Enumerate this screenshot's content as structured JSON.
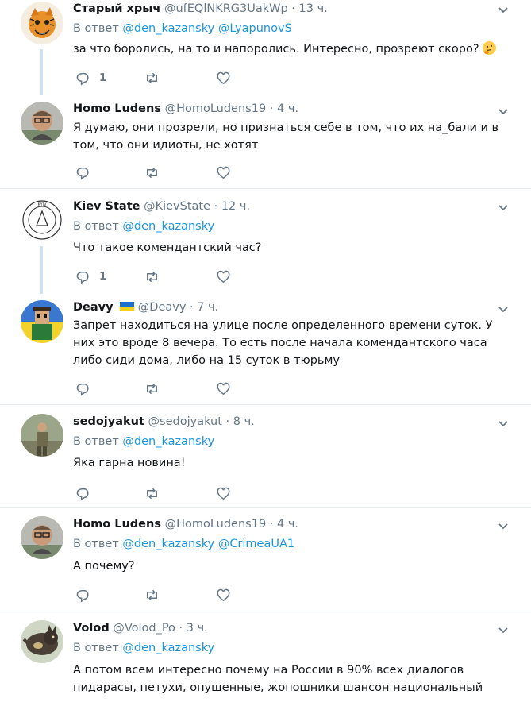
{
  "reply_prefix": "В ответ",
  "tweets": [
    {
      "name": "Старый хрыч",
      "handle": "@ufEQlNKRG3UakWp",
      "time": "13 ч.",
      "mentions": [
        "@den_kazansky",
        "@LyapunovS"
      ],
      "text": "за что боролись, на то и напоролись. Интересно, прозреют скоро?",
      "emoji": "thinking-face",
      "reply_count": "1"
    },
    {
      "name": "Homo Ludens",
      "handle": "@HomoLudens19",
      "time": "4 ч.",
      "mentions": [],
      "text": "Я думаю, они прозрели, но признаться себе в том, что их на_бали и в том, что они идиоты, не хотят",
      "reply_count": ""
    },
    {
      "name": "Kiev State",
      "handle": "@KievState",
      "time": "12 ч.",
      "mentions": [
        "@den_kazansky"
      ],
      "text": "Что такое комендантский час?",
      "reply_count": "1"
    },
    {
      "name": "Deavy",
      "handle": "@Deavy",
      "time": "7 ч.",
      "mentions": [],
      "text": "Запрет находиться на улице после определенного времени суток. У них это вроде 8 вечера. То есть после начала комендантского часа либо сиди дома, либо на 15 суток в тюрьму",
      "reply_count": ""
    },
    {
      "name": "sedojyakut",
      "handle": "@sedojyakut",
      "time": "8 ч.",
      "mentions": [
        "@den_kazansky"
      ],
      "text": "Яка гарна новина!",
      "reply_count": ""
    },
    {
      "name": "Homo Ludens",
      "handle": "@HomoLudens19",
      "time": "4 ч.",
      "mentions": [
        "@den_kazansky",
        "@CrimeaUA1"
      ],
      "text": "А почему?",
      "reply_count": ""
    },
    {
      "name": "Volod",
      "handle": "@Volod_Po",
      "time": "3 ч.",
      "mentions": [
        "@den_kazansky"
      ],
      "text": "А потом всем интересно почему на России в 90% всех диалогов пидарасы, петухи, опущенные, жопошники шансон национальный жанр...",
      "reply_count": ""
    }
  ],
  "colors": {
    "link": "#1b95e0",
    "muted": "#657786",
    "thread": "#cfe3f4",
    "separator": "#e6ecf0"
  }
}
